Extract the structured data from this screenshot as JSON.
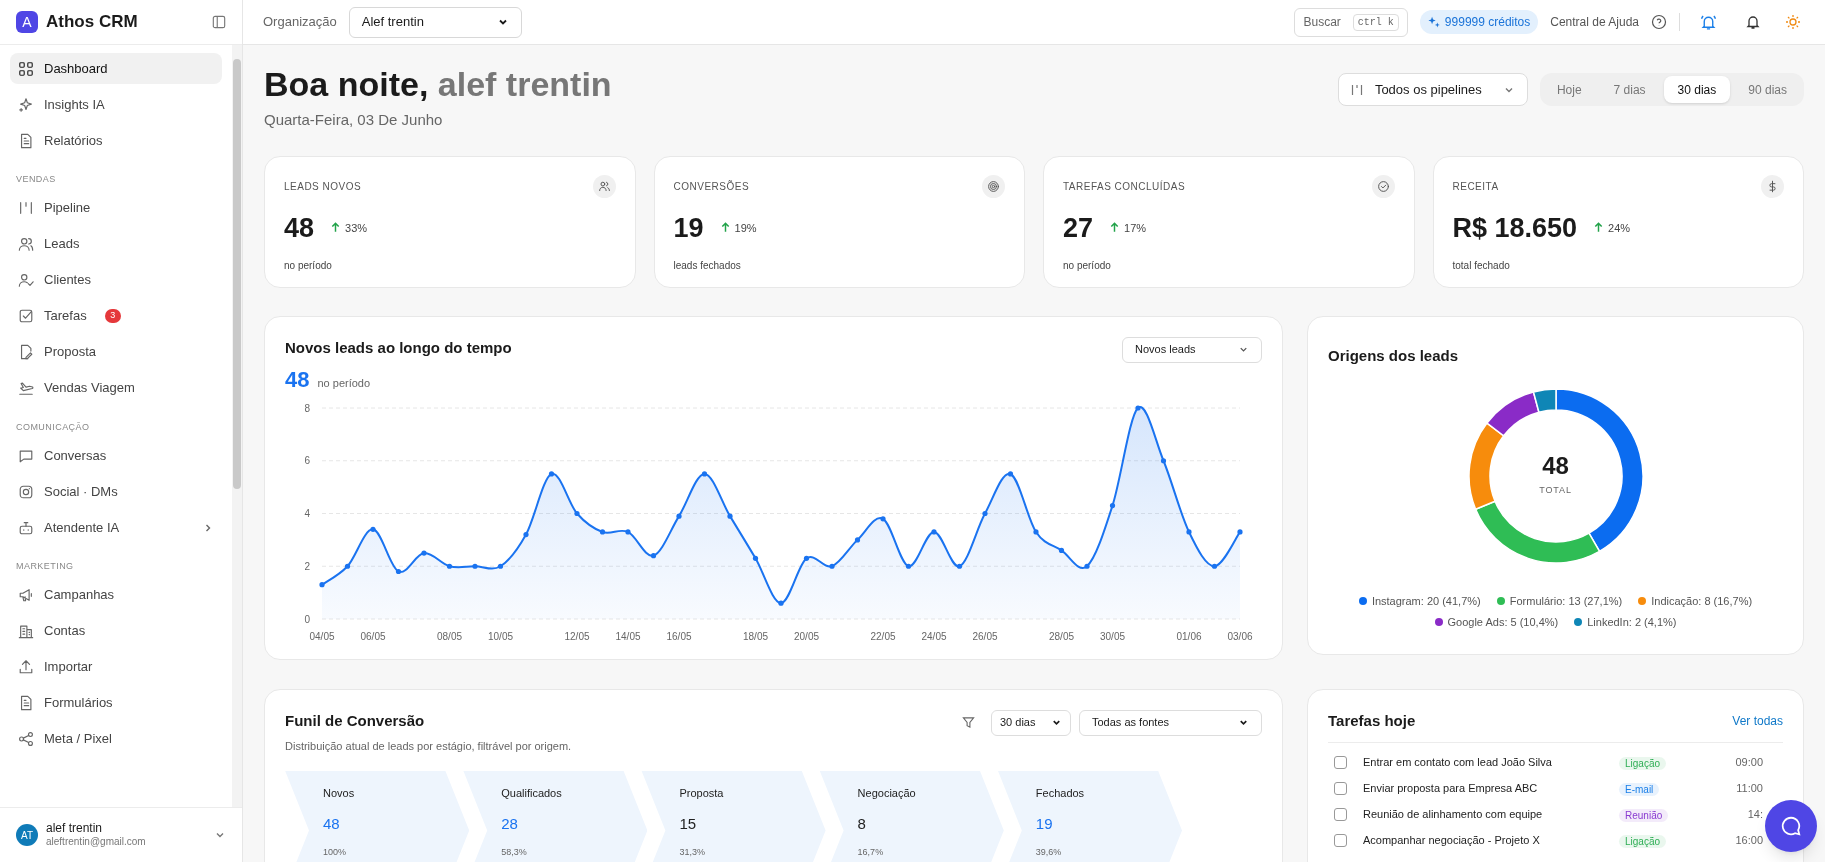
{
  "app": {
    "logo_letter": "A",
    "name": "Athos CRM"
  },
  "sidebar": {
    "sections": [
      {
        "items": [
          {
            "label": "Dashboard",
            "selected": true,
            "submenu": false
          },
          {
            "label": "Insights IA",
            "selected": false,
            "submenu": false
          },
          {
            "label": "Relatórios",
            "selected": false,
            "submenu": false
          }
        ]
      },
      {
        "title": "VENDAS",
        "items": [
          {
            "label": "Pipeline",
            "selected": false,
            "submenu": false
          },
          {
            "label": "Leads",
            "selected": false,
            "submenu": false
          },
          {
            "label": "Clientes",
            "selected": false,
            "submenu": false
          },
          {
            "label": "Tarefas",
            "selected": false,
            "submenu": false,
            "badge": "3"
          },
          {
            "label": "Proposta",
            "selected": false,
            "submenu": false
          },
          {
            "label": "Vendas Viagem",
            "selected": false,
            "submenu": false
          }
        ]
      },
      {
        "title": "COMUNICAÇÃO",
        "items": [
          {
            "label": "Conversas",
            "selected": false,
            "submenu": false
          },
          {
            "label": "Social · DMs",
            "selected": false,
            "submenu": false
          },
          {
            "label": "Atendente IA",
            "selected": false,
            "submenu": true
          }
        ]
      },
      {
        "title": "MARKETING",
        "items": [
          {
            "label": "Campanhas",
            "selected": false,
            "submenu": false
          },
          {
            "label": "Contas",
            "selected": false,
            "submenu": false
          },
          {
            "label": "Importar",
            "selected": false,
            "submenu": false
          },
          {
            "label": "Formulários",
            "selected": false,
            "submenu": false
          },
          {
            "label": "Meta / Pixel",
            "selected": false,
            "submenu": false
          }
        ]
      }
    ],
    "user": {
      "initials": "AT",
      "name": "alef trentin",
      "email": "aleftrentin@gmail.com"
    }
  },
  "top_bar": {
    "org_label": "Organização",
    "org_select": "Alef trentin",
    "search": {
      "label": "Buscar",
      "shortcut": "ctrl k"
    },
    "credits": "999999 créditos",
    "help": "Central de Ajuda"
  },
  "header": {
    "greeting": "Boa noite,",
    "user_name": "alef trentin",
    "date": "Quarta-Feira, 03 De Junho",
    "pipeline_select": "Todos os pipelines",
    "periods": [
      {
        "label": "Hoje",
        "selected": false
      },
      {
        "label": "7 dias",
        "selected": false
      },
      {
        "label": "30 dias",
        "selected": true
      },
      {
        "label": "90 dias",
        "selected": false
      }
    ]
  },
  "kpis": [
    {
      "label": "LEADS NOVOS",
      "value": "48",
      "change": "33%",
      "caption": "no período"
    },
    {
      "label": "CONVERSÕES",
      "value": "19",
      "change": "19%",
      "caption": "leads fechados"
    },
    {
      "label": "TAREFAS CONCLUÍDAS",
      "value": "27",
      "change": "17%",
      "caption": "no período"
    },
    {
      "label": "RECEITA",
      "value": "R$ 18.650",
      "change": "24%",
      "caption": "total fechado"
    }
  ],
  "leads_chart": {
    "title": "Novos leads ao longo do tempo",
    "total": "48",
    "total_caption": "no período",
    "chart_data": {
      "type": "area",
      "categories": [
        "04/05",
        null,
        "06/05",
        null,
        null,
        "08/05",
        null,
        "10/05",
        null,
        null,
        "12/05",
        null,
        "14/05",
        null,
        "16/05",
        null,
        null,
        "18/05",
        null,
        "20/05",
        null,
        null,
        "22/05",
        null,
        "24/05",
        null,
        "26/05",
        null,
        null,
        "28/05",
        null,
        "30/05",
        null,
        null,
        "01/06",
        null,
        "03/06"
      ],
      "series": [
        {
          "name": "Novos leads",
          "color": "#1a73f0",
          "values": [
            1.3,
            2,
            3.4,
            1.8,
            2.5,
            2,
            2,
            2,
            3.2,
            5.5,
            4,
            3.3,
            3.3,
            2.4,
            3.9,
            5.5,
            3.9,
            2.3,
            0.6,
            2.3,
            2,
            3,
            3.8,
            2,
            3.3,
            2,
            4,
            5.5,
            3.3,
            2.6,
            2,
            4.3,
            8,
            6,
            3.3,
            2,
            3.3
          ]
        }
      ],
      "ylim": [
        0,
        8
      ],
      "yticks": [
        0,
        2,
        4,
        6,
        8
      ],
      "grid": true
    }
  },
  "lead_sources": {
    "title": "Origens dos leads",
    "total": "48",
    "total_label": "TOTAL",
    "chart_data": {
      "type": "donut",
      "categories": [
        "Instagram: 20 (41,7%)",
        "Formulário: 13 (27,1%)",
        "Indicação: 8 (16,7%)",
        "Google Ads: 5 (10,4%)",
        "LinkedIn: 2 (4,1%)"
      ],
      "values": [
        20,
        13,
        8,
        5,
        2
      ]
    },
    "legend": [
      {
        "color": "#0b6cf0"
      },
      {
        "color": "#2fbd55"
      },
      {
        "color": "#f78c0c"
      },
      {
        "color": "#8a2bc7"
      },
      {
        "color": "#0f86b6"
      }
    ]
  },
  "funnel": {
    "title": "Funil de Conversão",
    "subtitle": "Distribuição atual de leads por estágio, filtrável por origem.",
    "period_select": "30 dias",
    "source_select": "Todas as fontes",
    "stages": [
      {
        "name": "Novos",
        "value": "48",
        "percent": "100%",
        "highlighted": true
      },
      {
        "name": "Qualificados",
        "value": "28",
        "percent": "58,3%",
        "highlighted": true
      },
      {
        "name": "Proposta",
        "value": "15",
        "percent": "31,3%",
        "highlighted": false
      },
      {
        "name": "Negociação",
        "value": "8",
        "percent": "16,7%",
        "highlighted": false
      },
      {
        "name": "Fechados",
        "value": "19",
        "percent": "39,6%",
        "highlighted": true
      }
    ]
  },
  "tasks": {
    "title": "Tarefas hoje",
    "link": "Ver todas",
    "items": [
      {
        "text": "Entrar em contato com lead João Silva",
        "tag": "Ligação",
        "color": "#2fae55",
        "time": "09:00",
        "checked": false
      },
      {
        "text": "Enviar proposta para Empresa ABC",
        "tag": "E-mail",
        "color": "#1a7fe8",
        "time": "11:00",
        "checked": false
      },
      {
        "text": "Reunião de alinhamento com equipe",
        "tag": "Reunião",
        "color": "#8a3bd1",
        "time": "14:",
        "checked": false
      },
      {
        "text": "Acompanhar negociação - Projeto X",
        "tag": "Ligação",
        "color": "#2fae55",
        "time": "16:00",
        "checked": false
      }
    ]
  }
}
